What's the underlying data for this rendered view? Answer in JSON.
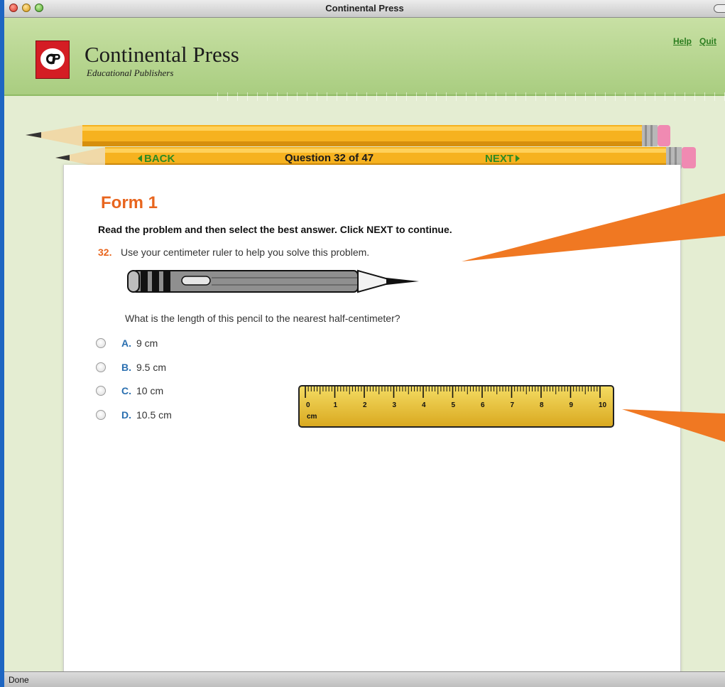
{
  "window": {
    "title": "Continental Press"
  },
  "header": {
    "brand": "Continental Press",
    "tagline": "Educational Publishers",
    "links": {
      "help": "Help",
      "quit": "Quit"
    }
  },
  "nav": {
    "back": "BACK",
    "next": "NEXT",
    "counter": "Question 32 of 47"
  },
  "question": {
    "form_title": "Form 1",
    "instruction": "Read the problem and then select the best answer. Click NEXT to continue.",
    "number": "32.",
    "text": "Use your centimeter ruler to help you solve this problem.",
    "subtext": "What is the length of this pencil to the nearest half-centimeter?",
    "choices": [
      {
        "letter": "A.",
        "text": "9 cm"
      },
      {
        "letter": "B.",
        "text": "9.5 cm"
      },
      {
        "letter": "C.",
        "text": "10 cm"
      },
      {
        "letter": "D.",
        "text": "10.5 cm"
      }
    ]
  },
  "ruler": {
    "unit": "cm",
    "labels": [
      "0",
      "1",
      "2",
      "3",
      "4",
      "5",
      "6",
      "7",
      "8",
      "9",
      "10"
    ]
  },
  "colors": {
    "accent_orange": "#e8651e",
    "nav_green": "#2e8a23",
    "choice_blue": "#2a6fb0",
    "header_green": "#b5d68e"
  },
  "status": {
    "text": "Done"
  }
}
